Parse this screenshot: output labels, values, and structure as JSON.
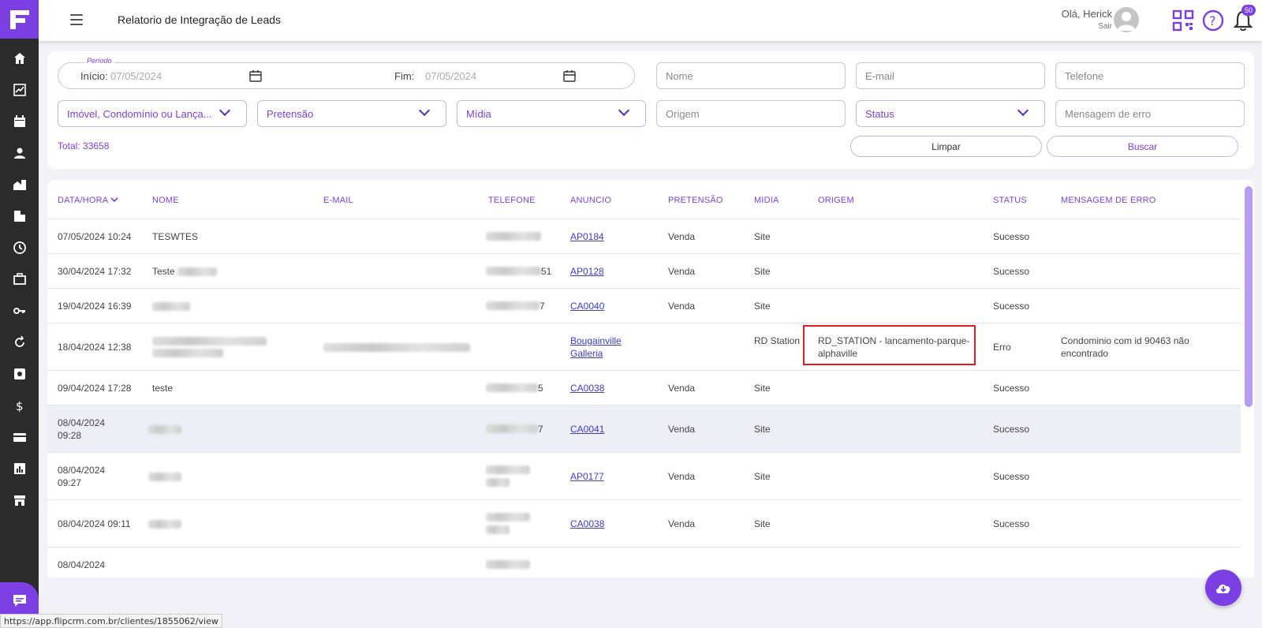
{
  "header": {
    "title": "Relatorio de Integração de Leads",
    "greeting": "Olá, Herick",
    "logout": "Sair",
    "notification_count": "50"
  },
  "filters": {
    "period_legend": "Período",
    "start_label": "Início:",
    "start_value": "07/05/2024",
    "end_label": "Fim:",
    "end_value": "07/05/2024",
    "name_placeholder": "Nome",
    "email_placeholder": "E-mail",
    "phone_placeholder": "Telefone",
    "property_select": "Imóvel, Condomínio ou Lança...",
    "pretension_select": "Pretensão",
    "media_select": "Mídia",
    "origin_placeholder": "Origem",
    "status_select": "Status",
    "error_placeholder": "Mensagem de erro",
    "total": "Total: 33658",
    "clear_label": "Limpar",
    "search_label": "Buscar"
  },
  "table": {
    "columns": [
      "DATA/HORA",
      "NOME",
      "E-MAIL",
      "TELEFONE",
      "ANUNCIO",
      "PRETENSÃO",
      "MIDIA",
      "ORIGEM",
      "STATUS",
      "MENSAGEM DE ERRO"
    ],
    "rows": [
      {
        "date": "07/05/2024 10:24",
        "name": "TESWTES",
        "phone_tail": "",
        "ad": "AP0184",
        "pretension": "Venda",
        "media": "Site",
        "origin": "",
        "status": "Sucesso",
        "error": ""
      },
      {
        "date": "30/04/2024 17:32",
        "name": "Teste",
        "phone_tail": "51",
        "ad": "AP0128",
        "pretension": "Venda",
        "media": "Site",
        "origin": "",
        "status": "Sucesso",
        "error": ""
      },
      {
        "date": "19/04/2024 16:39",
        "name": "",
        "phone_tail": "7",
        "ad": "CA0040",
        "pretension": "Venda",
        "media": "Site",
        "origin": "",
        "status": "Sucesso",
        "error": ""
      },
      {
        "date": "18/04/2024 12:38",
        "name": "",
        "phone_tail": "",
        "ad": "Bougainville Galleria",
        "pretension": "",
        "media": "RD Station",
        "origin": "RD_STATION - lancamento-parque-alphaville",
        "status": "Erro",
        "error": "Condominio com id 90463 não encontrado"
      },
      {
        "date": "09/04/2024 17:28",
        "name": "teste",
        "phone_tail": "5",
        "ad": "CA0038",
        "pretension": "Venda",
        "media": "Site",
        "origin": "",
        "status": "Sucesso",
        "error": ""
      },
      {
        "date": "08/04/2024 09:28",
        "name": "",
        "phone_tail": "7",
        "ad": "CA0041",
        "pretension": "Venda",
        "media": "Site",
        "origin": "",
        "status": "Sucesso",
        "error": ""
      },
      {
        "date": "08/04/2024 09:27",
        "name": "",
        "phone_tail": "",
        "ad": "AP0177",
        "pretension": "Venda",
        "media": "Site",
        "origin": "",
        "status": "Sucesso",
        "error": ""
      },
      {
        "date": "08/04/2024 09:11",
        "name": "",
        "phone_tail": "",
        "ad": "CA0038",
        "pretension": "Venda",
        "media": "Site",
        "origin": "",
        "status": "Sucesso",
        "error": ""
      },
      {
        "date": "08/04/2024",
        "name": "",
        "phone_tail": "",
        "ad": "",
        "pretension": "",
        "media": "",
        "origin": "",
        "status": "",
        "error": ""
      }
    ]
  },
  "statusbar": "https://app.flipcrm.com.br/clientes/1855062/view",
  "colors": {
    "accent": "#7b3fe4",
    "sidebar": "#2b2b2b",
    "highlight": "#e01e1e"
  }
}
